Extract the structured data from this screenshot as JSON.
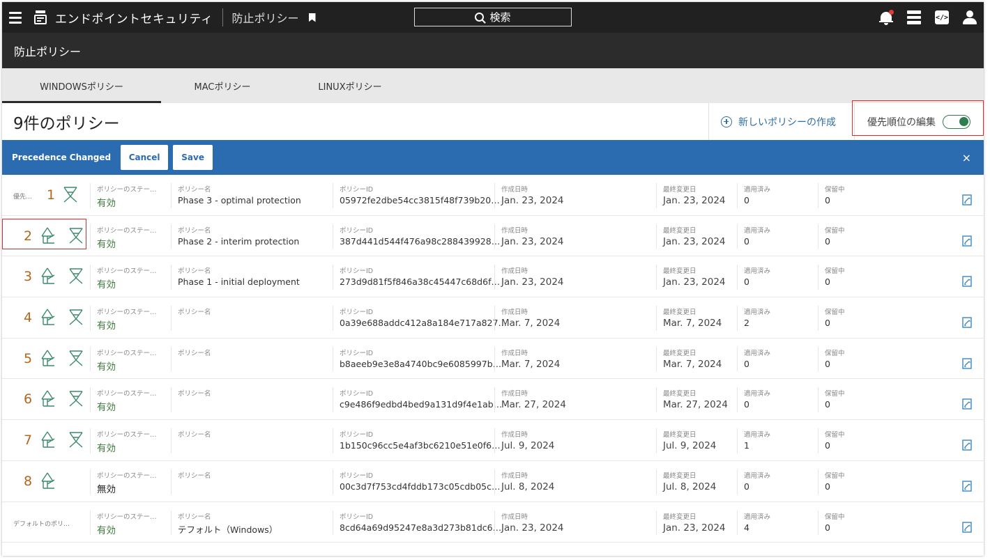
{
  "app": {
    "title": "エンドポイントセキュリティ",
    "breadcrumb": "防止ポリシー"
  },
  "search": {
    "label": "検索"
  },
  "subheader": {
    "title": "防止ポリシー"
  },
  "tabs": [
    {
      "label": "WINDOWSポリシー",
      "active": true
    },
    {
      "label": "MACポリシー",
      "active": false
    },
    {
      "label": "LINUXポリシー",
      "active": false
    }
  ],
  "list": {
    "count_label": "9件のポリシー",
    "new_policy_label": "新しいポリシーの作成",
    "edit_precedence_label": "優先順位の編集",
    "edit_precedence_on": true
  },
  "banner": {
    "message": "Precedence Changed",
    "cancel_label": "Cancel",
    "save_label": "Save",
    "close_symbol": "×"
  },
  "columns": {
    "status": "ポリシーのステー…",
    "name": "ポリシー名",
    "id": "ポリシーID",
    "created": "作成日時",
    "modified": "最終変更日",
    "applied": "適用済み",
    "pending": "保留中"
  },
  "precedence_header": "優先…",
  "default_precedence_label": "デフォルトのポリ…",
  "policies": [
    {
      "precedence": "1",
      "status": "有効",
      "name": "Phase 3 - optimal protection",
      "id": "05972fe2dbe54cc3815f48f739b20…",
      "created": "Jan. 23, 2024",
      "modified": "Jan. 23, 2024",
      "applied": "0",
      "pending": "0"
    },
    {
      "precedence": "2",
      "status": "有効",
      "name": "Phase 2 - interim protection",
      "id": "387d441d544f476a98c288439928…",
      "created": "Jan. 23, 2024",
      "modified": "Jan. 23, 2024",
      "applied": "0",
      "pending": "0"
    },
    {
      "precedence": "3",
      "status": "有効",
      "name": "Phase 1 - initial deployment",
      "id": "273d9d81f5f846a38c45447c68d6f…",
      "created": "Jan. 23, 2024",
      "modified": "Jan. 23, 2024",
      "applied": "0",
      "pending": "0"
    },
    {
      "precedence": "4",
      "status": "有効",
      "name": "",
      "id": "0a39e688addc412a8a184e717a827…",
      "created": "Mar. 7, 2024",
      "modified": "Mar. 7, 2024",
      "applied": "2",
      "pending": "0"
    },
    {
      "precedence": "5",
      "status": "有効",
      "name": "",
      "id": "b8aeeb9e3e8a4740bc9e6085997b…",
      "created": "Mar. 7, 2024",
      "modified": "Mar. 7, 2024",
      "applied": "0",
      "pending": "0"
    },
    {
      "precedence": "6",
      "status": "有効",
      "name": "",
      "id": "c9e486f9edbd4bed9a131d9f4e1ab…",
      "created": "Mar. 27, 2024",
      "modified": "Mar. 27, 2024",
      "applied": "0",
      "pending": "0"
    },
    {
      "precedence": "7",
      "status": "有効",
      "name": "",
      "id": "1b150c96cc5e4af3bc6210e51e0f6…",
      "created": "Jul. 9, 2024",
      "modified": "Jul. 9, 2024",
      "applied": "1",
      "pending": "0"
    },
    {
      "precedence": "8",
      "status": "無効",
      "name": "",
      "id": "00c3d7f753cd4fddb173c05cdb05c…",
      "created": "Jul. 8, 2024",
      "modified": "Jul. 8, 2024",
      "applied": "0",
      "pending": "0"
    },
    {
      "precedence": "",
      "status": "有効",
      "name": "テフォルト（Windows）",
      "id": "8cd64a69d95247e8a3d273b81dc6…",
      "created": "Jan. 23, 2024",
      "modified": "Jan. 23, 2024",
      "applied": "4",
      "pending": "0"
    }
  ],
  "colors": {
    "banner": "#2b6cb0",
    "active_status": "#3c7a3a",
    "precedence_number": "#b5651d",
    "highlight": "#d32f2f"
  }
}
